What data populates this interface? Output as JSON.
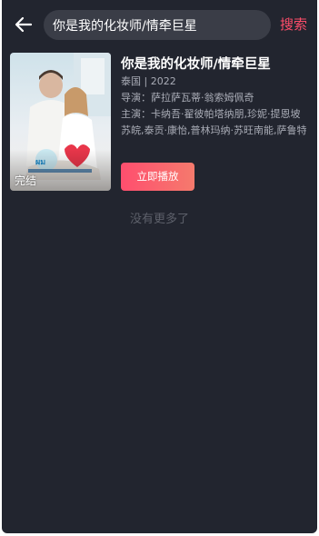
{
  "header": {
    "back_icon": "arrow-left-icon",
    "search_value": "你是我的化妆师/情牵巨星",
    "search_button_label": "搜索",
    "accent_color": "#ff4d6a"
  },
  "result": {
    "title": "你是我的化妆师/情牵巨星",
    "meta": "泰国 | 2022",
    "director_label": "导演：",
    "director": "萨拉萨瓦蒂·翁索姆佩奇",
    "cast_label": "主演：",
    "cast_line1": "卡纳吾·翟彼帕塔纳朋,珍妮·提恩坡",
    "cast_line2": "苏皖,泰贡·康怡,普林玛纳·苏旺南能,萨鲁特",
    "status_badge": "完结",
    "play_button_label": "立即播放"
  },
  "footer": {
    "no_more_text": "没有更多了"
  }
}
